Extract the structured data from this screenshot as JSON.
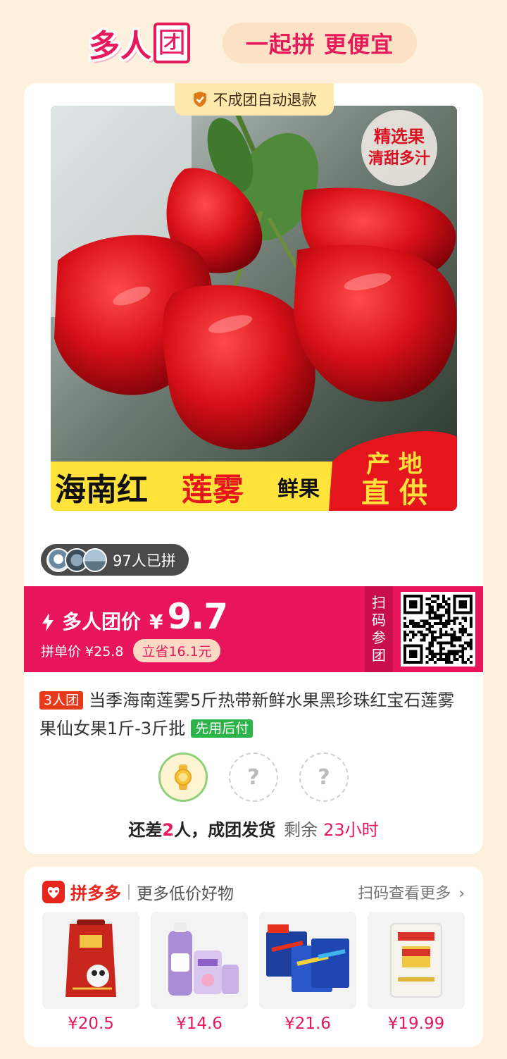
{
  "header": {
    "logo_main": "多人",
    "logo_box": "团",
    "slogan": "一起拼 更便宜"
  },
  "product": {
    "refund_tag": "不成团自动退款",
    "image_texts": {
      "corner_badge_line1": "精选果",
      "corner_badge_line2": "清甜多汁",
      "banner_part1": "海南红",
      "banner_part2": "莲雾",
      "banner_part3": "鲜果",
      "banner_right_line1": "产 地",
      "banner_right_line2": "直 供"
    },
    "joined_text": "97人已拼",
    "price_label": "多人团价",
    "currency": "¥",
    "group_price": "9.7",
    "single_price_text": "拼单价 ¥25.8",
    "save_text": "立省16.1元",
    "scan_text": [
      "扫",
      "码",
      "参",
      "团"
    ],
    "team_tag": "3人团",
    "title": "当季海南莲雾5斤热带新鲜水果黑珍珠红宝石莲雾果仙女果1斤-3斤批",
    "pay_tag": "先用后付",
    "slot_placeholder": "?",
    "status_prefix": "还差",
    "status_num": "2",
    "status_suffix": "人，成团发货",
    "remain_label": "剩余",
    "remain_time": "23小时"
  },
  "more": {
    "brand": "拼多多",
    "subtitle": "更多低价好物",
    "scan_more": "扫码查看更多",
    "items": [
      {
        "price": "¥20.5",
        "icon": "rice-bag-icon"
      },
      {
        "price": "¥14.6",
        "icon": "softener-bottle-icon"
      },
      {
        "price": "¥21.6",
        "icon": "toothbrush-pack-icon"
      },
      {
        "price": "¥19.99",
        "icon": "flour-bag-icon"
      }
    ]
  },
  "colors": {
    "brand_pink": "#e8155d",
    "background": "#fdf0dc",
    "pdd_red": "#e8251d",
    "green_tag": "#2cb44a"
  }
}
